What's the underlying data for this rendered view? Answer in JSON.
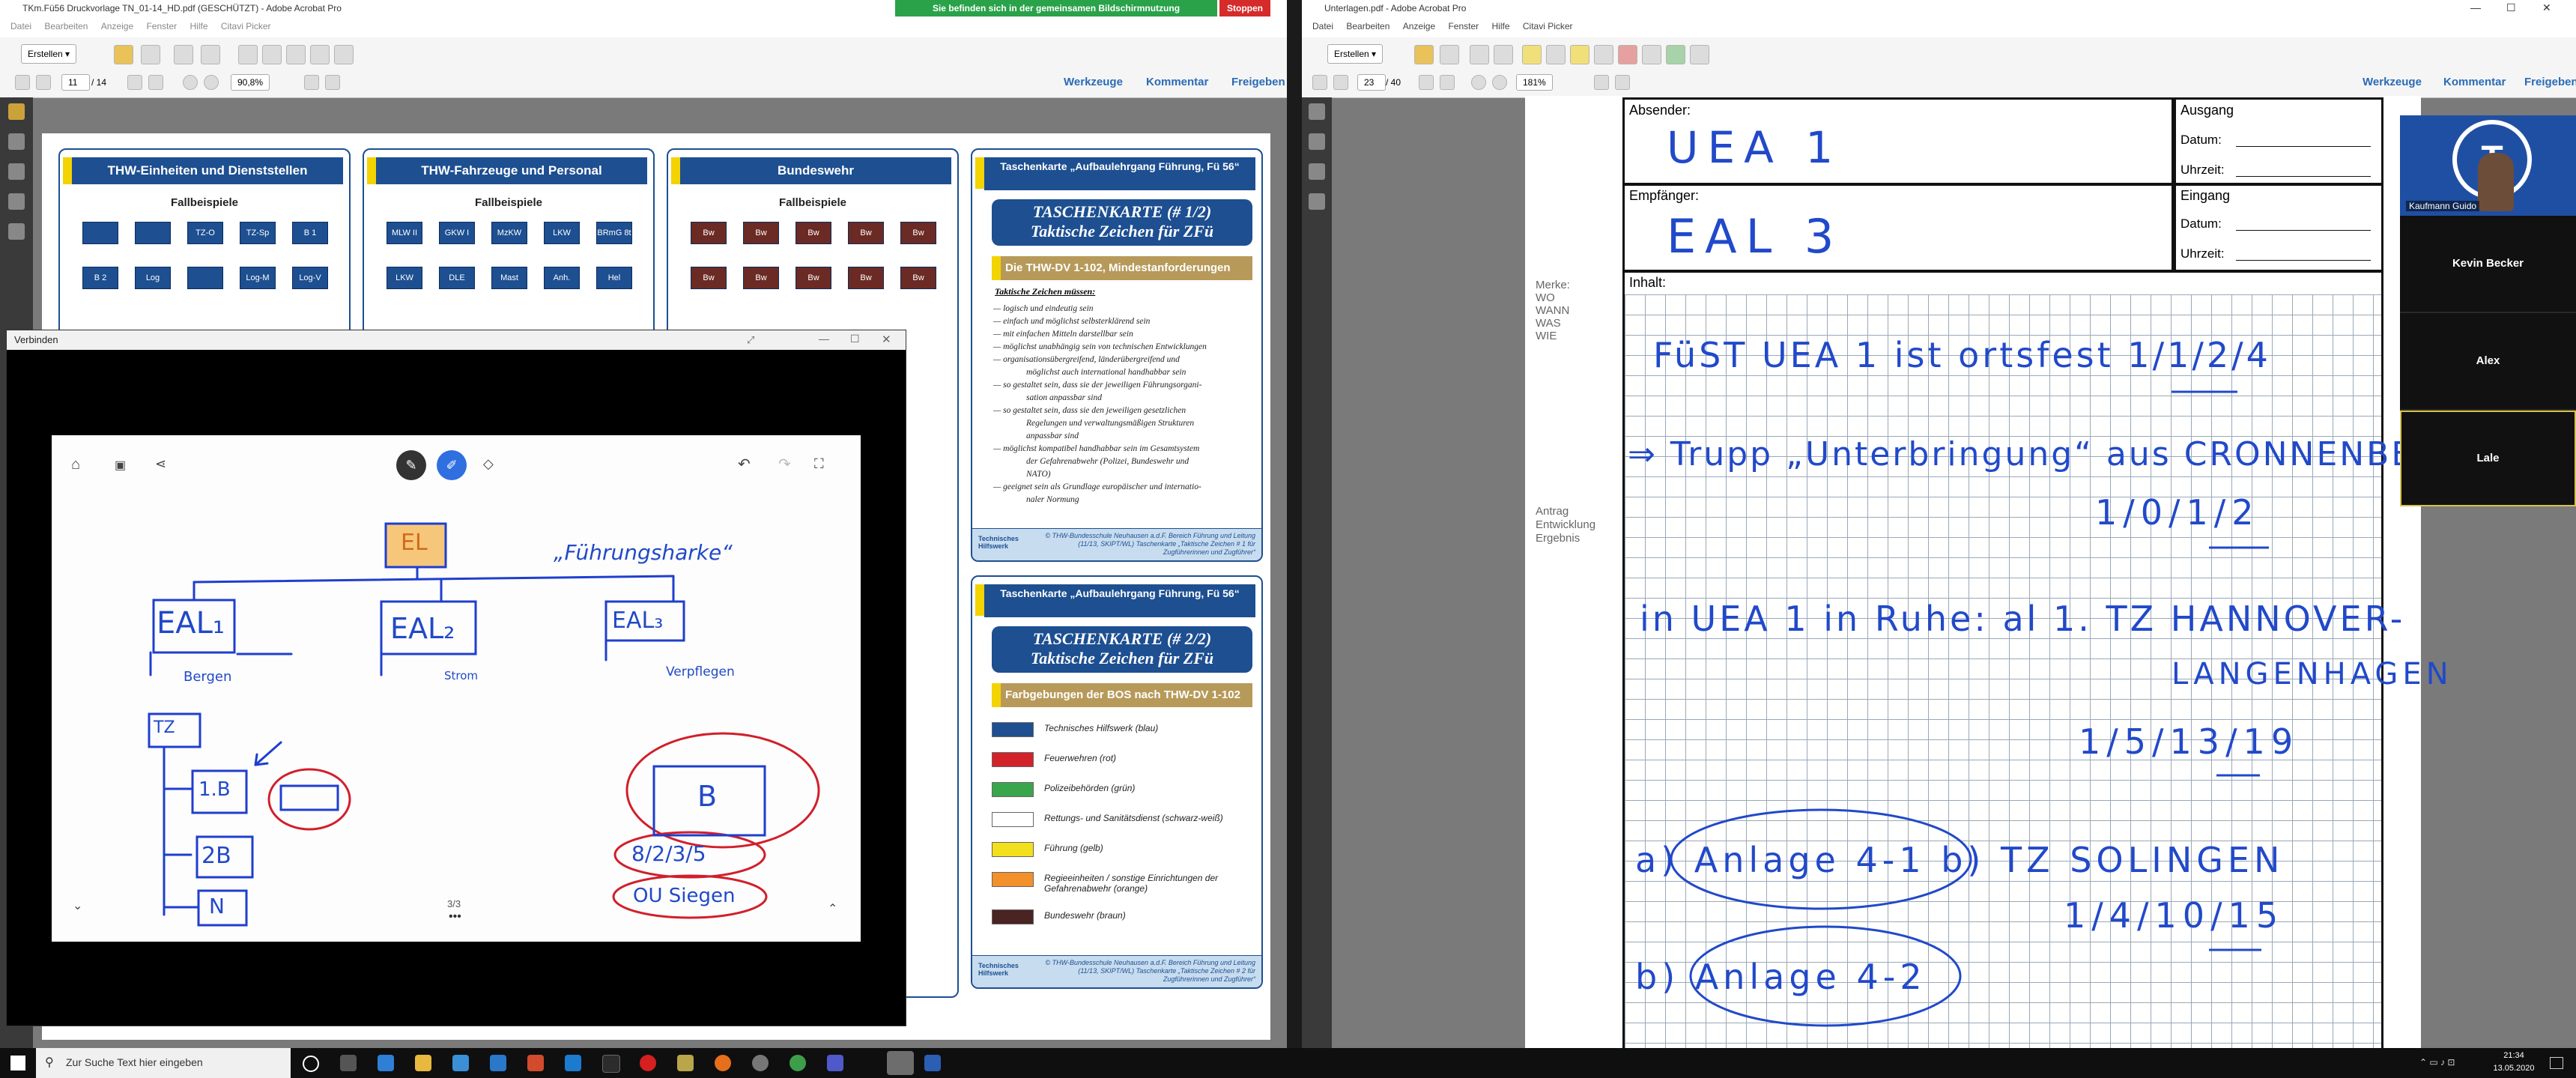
{
  "left_window": {
    "title": "TKm.Fü56 Druckvorlage TN_01-14_HD.pdf (GESCHÜTZT) - Adobe Acrobat Pro",
    "menu": [
      "Datei",
      "Bearbeiten",
      "Anzeige",
      "Fenster",
      "Hilfe",
      "Citavi Picker"
    ],
    "create_label": "Erstellen",
    "page_current": "11",
    "page_total": "/ 14",
    "zoom": "90,8%",
    "links": [
      "Werkzeuge",
      "Kommentar",
      "Freigeben"
    ],
    "panels": [
      {
        "title": "THW-Einheiten und Dienststellen",
        "sub": "Fallbeispiele"
      },
      {
        "title": "THW-Fahrzeuge und Personal",
        "sub": "Fallbeispiele"
      },
      {
        "title": "Bundeswehr",
        "sub": "Fallbeispiele"
      }
    ],
    "thw_symbols": [
      "",
      "",
      "TZ-O",
      "TZ-Sp",
      "B 1",
      "B 2",
      "Log",
      "",
      "Log-M",
      "Log-V"
    ],
    "veh_symbols": [
      "MLW II",
      "GKW I",
      "MzKW",
      "LKW Lbw",
      "BRmG 8t",
      "LKW",
      "DLE",
      "Mast",
      "Anh.",
      "Hel"
    ],
    "bw_symbols": [
      "Bw",
      "Bw",
      "Bw",
      "Bw",
      "Bw",
      "Bw",
      "Bw",
      "Bw",
      "Bw",
      "Bw"
    ],
    "tk1": {
      "header": "Taschenkarte „Aufbaulehrgang Führung, Fü 56“",
      "title_line1": "TASCHENKARTE (# 1/2)",
      "title_line2": "Taktische Zeichen für ZFü",
      "section": "Die THW-DV 1-102, Mindestanforderungen",
      "subhead": "Taktische Zeichen müssen:",
      "items": [
        "— logisch und eindeutig sein",
        "— einfach und möglichst selbsterklärend sein",
        "— mit einfachen Mitteln darstellbar sein",
        "— möglichst unabhängig sein von technischen Entwicklungen",
        "— organisationsübergreifend, länderübergreifend und",
        "   möglichst auch international handhabbar sein",
        "— so gestaltet sein, dass sie der jeweiligen Führungsorgani-",
        "   sation anpassbar sind",
        "— so gestaltet sein, dass sie den jeweiligen gesetzlichen",
        "   Regelungen und verwaltungsmäßigen Strukturen",
        "   anpassbar sind",
        "— möglichst kompatibel handhabbar sein im Gesamtsystem",
        "   der Gefahrenabwehr (Polizei, Bundeswehr und",
        "   NATO)",
        "— geeignet sein als Grundlage europäischer und internatio-",
        "   naler Normung"
      ],
      "footer_org": "Technisches Hilfswerk",
      "footer": "© THW-Bundesschule Neuhausen a.d.F. Bereich Führung und Leitung (11/13, SKIPT/WL) Taschenkarte „Taktische Zeichen # 1 für Zugführerinnen und Zugführer“"
    },
    "tk2": {
      "header": "Taschenkarte „Aufbaulehrgang Führung, Fü 56“",
      "title_line1": "TASCHENKARTE (# 2/2)",
      "title_line2": "Taktische Zeichen für ZFü",
      "section": "Farbgebungen der BOS nach THW-DV 1-102",
      "legend": [
        {
          "label": "Technisches Hilfswerk (blau)",
          "color": "#1d4f91"
        },
        {
          "label": "Feuerwehren (rot)",
          "color": "#d2232a"
        },
        {
          "label": "Polizeibehörden (grün)",
          "color": "#3aa64b"
        },
        {
          "label": "Rettungs- und Sanitätsdienst (schwarz-weiß)",
          "color": "#ffffff"
        },
        {
          "label": "Führung (gelb)",
          "color": "#f3e01c"
        },
        {
          "label": "Regieeinheiten / sonstige Einrichtungen der Gefahrenabwehr (orange)",
          "color": "#f2902a"
        },
        {
          "label": "Bundeswehr (braun)",
          "color": "#4a2323"
        }
      ],
      "footer_org": "Technisches Hilfswerk",
      "footer": "© THW-Bundesschule Neuhausen a.d.F. Bereich Führung und Leitung (11/13, SKIPT/WL) Taschenkarte „Taktische Zeichen # 2 für Zugführerinnen und Zugführer“"
    }
  },
  "share_banner": {
    "text": "Sie befinden sich in der gemeinsamen Bildschirmnutzung",
    "stop": "Stoppen"
  },
  "connect_window": {
    "title": "Verbinden",
    "page_indicator": "3/3",
    "drawing": {
      "el": "EL",
      "quote": "„Führungsharke“",
      "eal1": "EAL₁",
      "eal2": "EAL₂",
      "eal3": "EAL₃",
      "n_bergen": "Bergen",
      "n_strom": "Strom",
      "n_verpfl": "Verpflegen",
      "tz": "TZ",
      "b1": "1.B",
      "b2": "2B",
      "n": "N",
      "b": "B",
      "date": "8/2/3/5",
      "ou": "OU Siegen"
    }
  },
  "right_window": {
    "title": "Unterlagen.pdf - Adobe Acrobat Pro",
    "menu": [
      "Datei",
      "Bearbeiten",
      "Anzeige",
      "Fenster",
      "Hilfe",
      "Citavi Picker"
    ],
    "create_label": "Erstellen",
    "page_current": "23",
    "page_total": "/ 40",
    "zoom": "181%",
    "links": [
      "Werkzeuge",
      "Kommentar",
      "Freigeben"
    ],
    "form": {
      "absender_label": "Absender:",
      "absender_value": "UEA 1",
      "empfaenger_label": "Empfänger:",
      "empfaenger_value": "EAL 3",
      "ausgang": "Ausgang",
      "eingang": "Eingang",
      "datum": "Datum:",
      "uhrzeit": "Uhrzeit:",
      "inhalt": "Inhalt:",
      "merke": [
        "Merke:",
        "WO",
        "WANN",
        "WAS",
        "WIE"
      ],
      "antrag": [
        "Antrag",
        "Entwicklung",
        "Ergebnis"
      ],
      "lines": [
        "FüST UEA 1 ist ortsfest  1/1/2/4",
        "⇒ Trupp „Unterbringung“ aus CRONNENBERG",
        "1/0/1/2",
        "in UEA 1 in Ruhe: al 1. TZ HANNOVER-",
        "LANGENHAGEN",
        "1/5/13/19",
        "a) Anlage 4-1   b) TZ SOLINGEN",
        "1/4/10/15",
        "b) Anlage 4-2"
      ]
    }
  },
  "participants": [
    {
      "name": "Kaufmann Guido"
    },
    {
      "name": "Kevin Becker"
    },
    {
      "name": "Alex"
    },
    {
      "name": "Lale"
    }
  ],
  "taskbar": {
    "search_placeholder": "Zur Suche Text hier eingeben",
    "time": "21:34",
    "date": "13.05.2020"
  }
}
